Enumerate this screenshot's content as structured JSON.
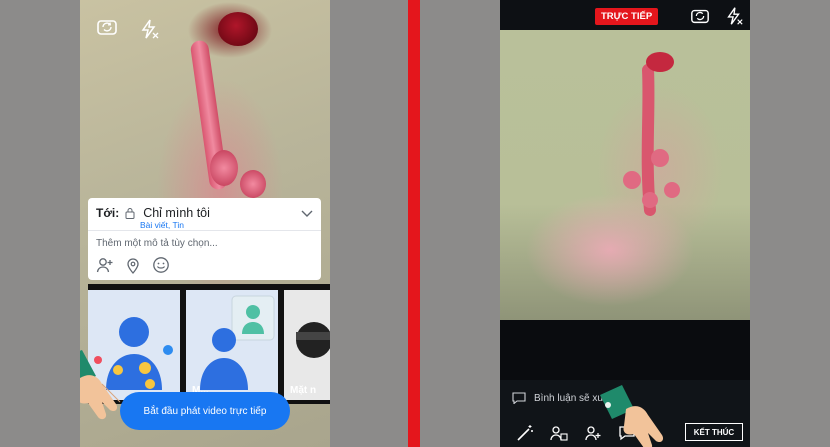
{
  "left": {
    "audience": {
      "to_label": "Tới:",
      "privacy": "Chỉ mình tôi",
      "privacy_sub": "Bài viết, Tin",
      "description_placeholder": "Thêm một mô tả tùy chọn..."
    },
    "tiles": [
      {
        "label": "...."
      },
      {
        "label": "M..."
      },
      {
        "label": "Mặt n"
      }
    ],
    "start_button": "Bắt đầu phát video trực tiếp"
  },
  "right": {
    "live_badge": "TRỰC TIẾP",
    "comment_hint": "Bình luận sẽ xuất...",
    "end_button": "KẾT THÚC"
  },
  "colors": {
    "accent": "#1877f2",
    "live_red": "#e4161c",
    "divider": "#e4161c"
  }
}
